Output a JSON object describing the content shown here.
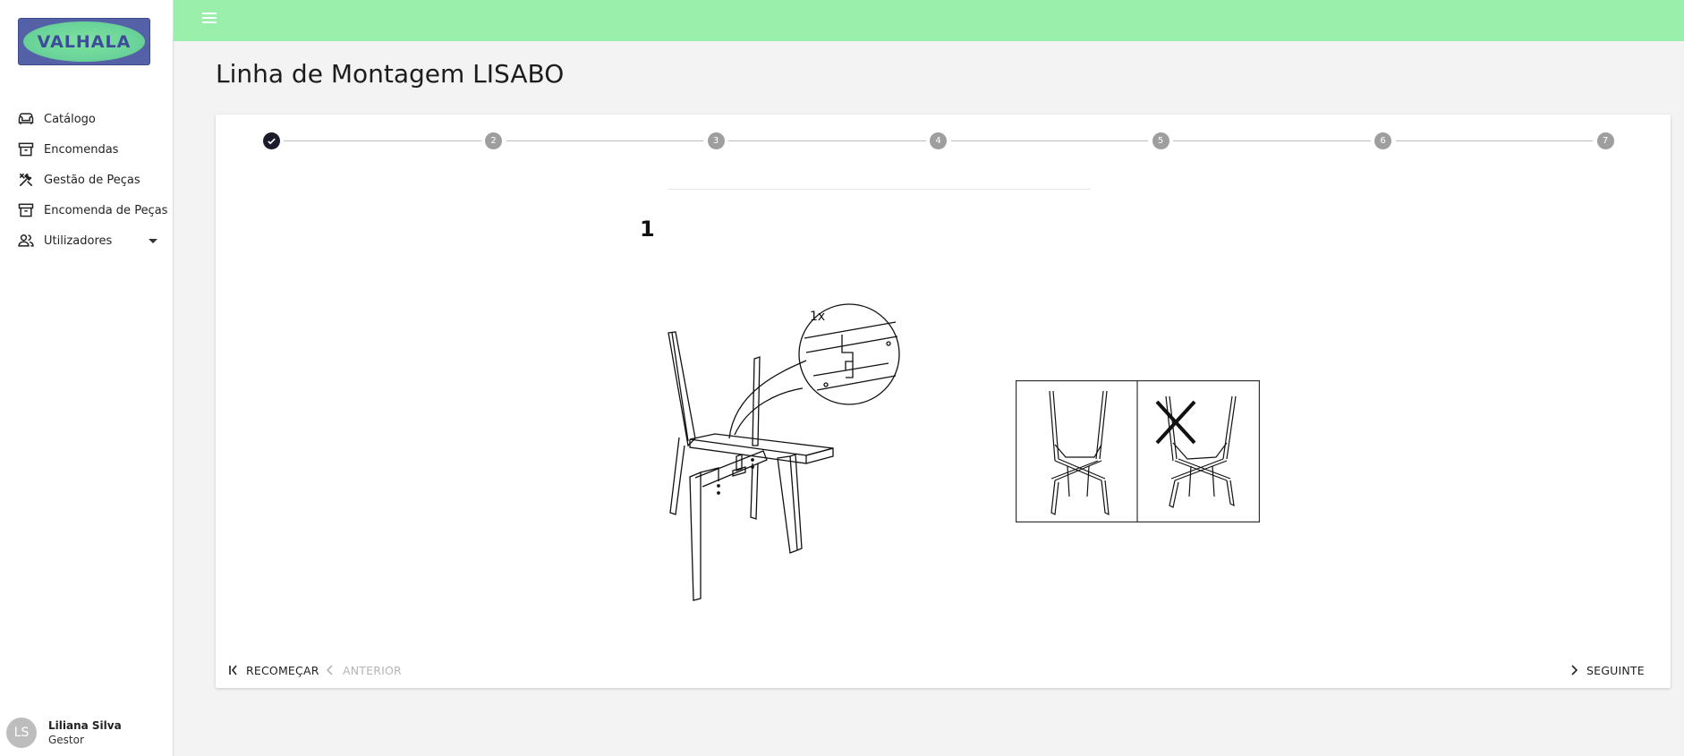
{
  "app": {
    "logo_text": "VALHALA"
  },
  "sidebar": {
    "items": [
      {
        "label": "Catálogo",
        "icon": "sofa-icon"
      },
      {
        "label": "Encomendas",
        "icon": "archive-icon"
      },
      {
        "label": "Gestão de Peças",
        "icon": "tools-icon"
      },
      {
        "label": "Encomenda de Peças",
        "icon": "archive-icon"
      },
      {
        "label": "Utilizadores",
        "icon": "users-icon",
        "expandable": true
      }
    ]
  },
  "user": {
    "initials": "LS",
    "name": "Liliana Silva",
    "role": "Gestor"
  },
  "page": {
    "title": "Linha de Montagem LISABO"
  },
  "stepper": {
    "steps": [
      "1",
      "2",
      "3",
      "4",
      "5",
      "6",
      "7"
    ],
    "completed": [
      1
    ]
  },
  "instruction": {
    "step_number": "1",
    "callout_label": "1x"
  },
  "footer": {
    "restart_label": "RECOMEÇAR",
    "previous_label": "ANTERIOR",
    "next_label": "SEGUINTE"
  },
  "colors": {
    "topbar": "#9aefaa",
    "logo_bg": "#5561a6",
    "logo_ellipse": "#6bd49a",
    "step_done": "#1b1b2b",
    "step_pending": "#9e9e9e"
  }
}
